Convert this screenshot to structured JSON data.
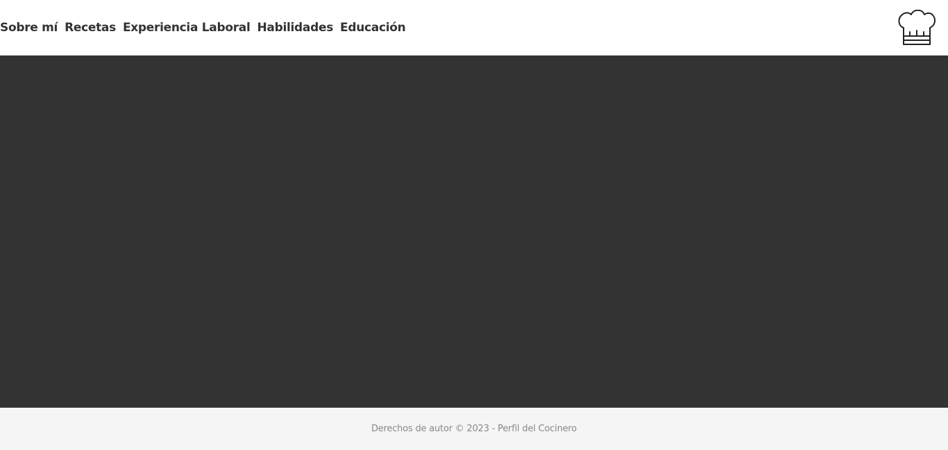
{
  "nav": {
    "items": [
      {
        "label": "Sobre mí"
      },
      {
        "label": "Recetas"
      },
      {
        "label": "Experiencia Laboral"
      },
      {
        "label": "Habilidades"
      },
      {
        "label": "Educación"
      }
    ]
  },
  "logo": {
    "icon": "chef-hat-icon"
  },
  "footer": {
    "copyright": "Derechos de autor © 2023 - Perfil del Cocinero"
  },
  "colors": {
    "nav_text": "#333333",
    "hero_background": "#333333",
    "footer_background": "#f5f5f5",
    "footer_text": "#888888"
  }
}
